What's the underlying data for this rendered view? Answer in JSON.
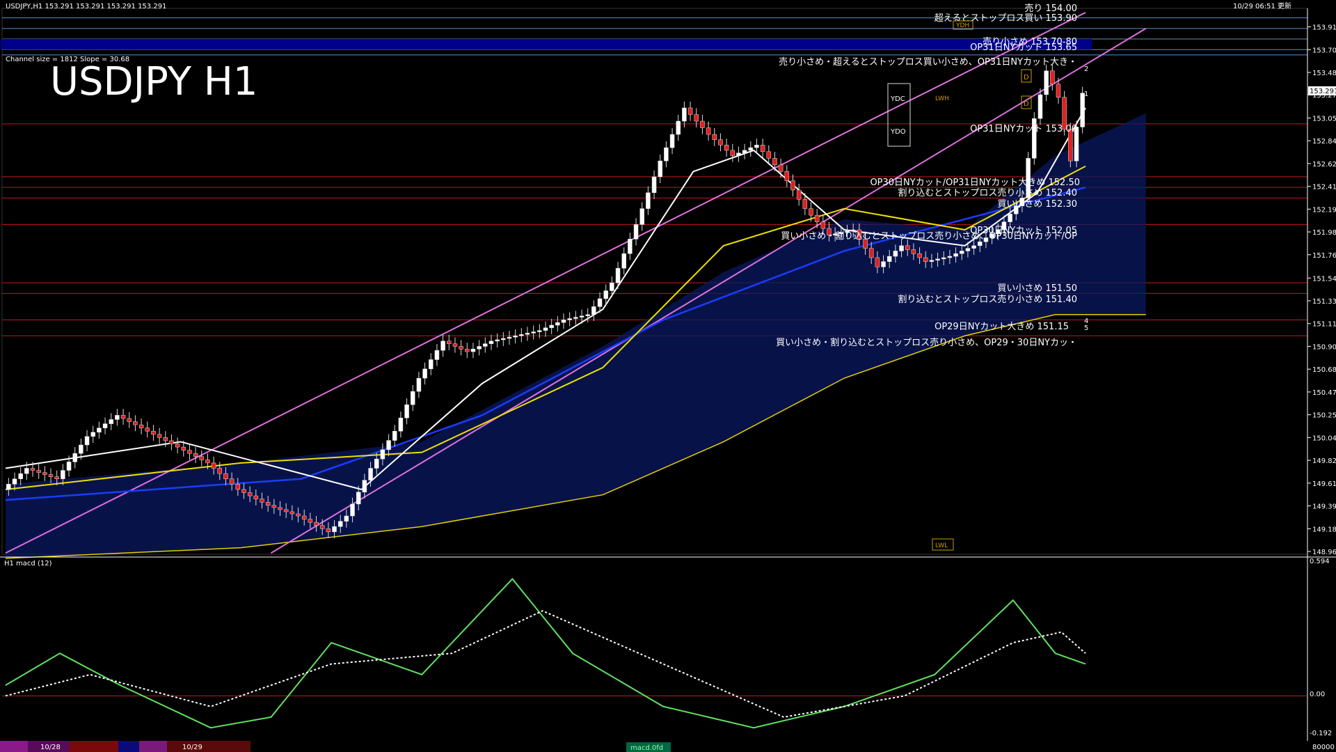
{
  "header": {
    "symbol_line": "USDJPY,H1  153.291 153.291 153.291 153.291",
    "datetime": "10/29 06:51 更新",
    "big_title": "USDJPY H1",
    "channel_info": "Channel size = 1812 Slope = 30.68"
  },
  "price_axis": {
    "ticks": [
      "153.915",
      "153.700",
      "153.485",
      "153.275",
      "153.055",
      "152.840",
      "152.625",
      "152.410",
      "152.195",
      "151.980",
      "151.765",
      "151.545",
      "151.330",
      "151.115",
      "150.900",
      "150.685",
      "150.470",
      "150.255",
      "150.040",
      "149.825",
      "149.610",
      "149.395",
      "149.180",
      "148.965"
    ],
    "current": "153.291"
  },
  "macd": {
    "title": "H1  macd (12)",
    "ticks": [
      "0.594",
      "0.00",
      "-0.192"
    ],
    "zero_label": "0.00"
  },
  "annotations": [
    {
      "text": "売り 154.00",
      "kind": "level"
    },
    {
      "text": "超えるとストップロス買い 153.90",
      "kind": "level"
    },
    {
      "text": "売り小さめ 153.70-80",
      "kind": "zone"
    },
    {
      "text": "OP31日NYカット 153.65",
      "kind": "level"
    },
    {
      "text": "売り小さめ・超えるとストップロス買い小さめ、OP31日NYカット大き・",
      "kind": "note"
    },
    {
      "text": "OP31日NYカット 153.00",
      "kind": "level"
    },
    {
      "text": "OP30日NYカット/OP31日NYカット大きめ 152.50",
      "kind": "level"
    },
    {
      "text": "割り込むとストップロス売り小さめ 152.40",
      "kind": "level"
    },
    {
      "text": "買い小さめ 152.30",
      "kind": "level"
    },
    {
      "text": "OP30日NYカット 152.05",
      "kind": "level"
    },
    {
      "text": "買い小さめ・割り込むとストップロス売り小さめ、OP30日NYカット/OP",
      "kind": "note"
    },
    {
      "text": "買い小さめ 151.50",
      "kind": "level"
    },
    {
      "text": "割り込むとストップロス売り小さめ 151.40",
      "kind": "level"
    },
    {
      "text": "OP29日NYカット大きめ 151.15",
      "kind": "level"
    },
    {
      "text": "買い小さめ・割り込むとストップロス売り小さめ、OP29・30日NYカッ・",
      "kind": "note"
    }
  ],
  "markers": {
    "ydh": "YDH",
    "ydc": "YDC",
    "ydo": "YDO",
    "lwh": "LWH",
    "lwl": "LWL",
    "d": "D",
    "n1": "1",
    "n2": "2",
    "n4": "4",
    "n5": "5"
  },
  "bottom_bar": {
    "left_date": "10/28",
    "mid_date": "10/29",
    "indicator_tab": "macd.0fd",
    "right_value": "80000"
  },
  "chart_data": {
    "type": "line",
    "title": "USDJPY H1",
    "ylim": [
      148.965,
      154.05
    ],
    "x": {
      "start": 1,
      "end": 180
    },
    "key_levels": [
      154.0,
      153.9,
      153.8,
      153.7,
      153.65,
      153.0,
      152.5,
      152.4,
      152.3,
      152.05,
      151.5,
      151.4,
      151.15,
      151.0
    ],
    "close_path": [
      [
        1,
        149.55
      ],
      [
        5,
        149.75
      ],
      [
        10,
        149.65
      ],
      [
        15,
        150.05
      ],
      [
        20,
        150.25
      ],
      [
        25,
        150.1
      ],
      [
        30,
        149.95
      ],
      [
        35,
        149.8
      ],
      [
        40,
        149.55
      ],
      [
        45,
        149.4
      ],
      [
        50,
        149.3
      ],
      [
        55,
        149.15
      ],
      [
        58,
        149.3
      ],
      [
        62,
        149.75
      ],
      [
        66,
        150.1
      ],
      [
        70,
        150.6
      ],
      [
        74,
        150.95
      ],
      [
        78,
        150.85
      ],
      [
        82,
        150.95
      ],
      [
        86,
        151.0
      ],
      [
        90,
        151.05
      ],
      [
        94,
        151.15
      ],
      [
        98,
        151.2
      ],
      [
        102,
        151.5
      ],
      [
        106,
        152.05
      ],
      [
        110,
        152.65
      ],
      [
        114,
        153.15
      ],
      [
        118,
        152.9
      ],
      [
        122,
        152.7
      ],
      [
        126,
        152.8
      ],
      [
        130,
        152.55
      ],
      [
        134,
        152.2
      ],
      [
        138,
        151.95
      ],
      [
        142,
        152.0
      ],
      [
        146,
        151.65
      ],
      [
        150,
        151.85
      ],
      [
        154,
        151.7
      ],
      [
        158,
        151.75
      ],
      [
        162,
        151.85
      ],
      [
        166,
        152.0
      ],
      [
        170,
        152.3
      ],
      [
        172,
        153.05
      ],
      [
        174,
        153.5
      ],
      [
        176,
        153.25
      ],
      [
        178,
        152.65
      ],
      [
        180,
        153.29
      ]
    ],
    "ma_fast": [
      [
        1,
        149.75
      ],
      [
        30,
        150.0
      ],
      [
        60,
        149.55
      ],
      [
        80,
        150.55
      ],
      [
        100,
        151.25
      ],
      [
        115,
        152.55
      ],
      [
        125,
        152.75
      ],
      [
        140,
        152.0
      ],
      [
        160,
        151.85
      ],
      [
        172,
        152.35
      ],
      [
        180,
        153.15
      ]
    ],
    "ma_mid": [
      [
        1,
        149.55
      ],
      [
        40,
        149.8
      ],
      [
        70,
        149.9
      ],
      [
        100,
        150.7
      ],
      [
        120,
        151.85
      ],
      [
        140,
        152.2
      ],
      [
        160,
        152.0
      ],
      [
        180,
        152.6
      ]
    ],
    "ma_slow": [
      [
        1,
        149.45
      ],
      [
        50,
        149.65
      ],
      [
        80,
        150.25
      ],
      [
        110,
        151.15
      ],
      [
        140,
        151.8
      ],
      [
        180,
        152.4
      ]
    ],
    "channel_upper": [
      [
        1,
        148.95
      ],
      [
        180,
        154.05
      ]
    ],
    "channel_lower": [
      [
        45,
        148.95
      ],
      [
        190,
        153.9
      ]
    ],
    "macd_line": [
      [
        1,
        0.05
      ],
      [
        10,
        0.2
      ],
      [
        20,
        0.05
      ],
      [
        35,
        -0.15
      ],
      [
        45,
        -0.1
      ],
      [
        55,
        0.25
      ],
      [
        70,
        0.1
      ],
      [
        85,
        0.55
      ],
      [
        95,
        0.2
      ],
      [
        110,
        -0.05
      ],
      [
        125,
        -0.15
      ],
      [
        140,
        -0.05
      ],
      [
        155,
        0.1
      ],
      [
        168,
        0.45
      ],
      [
        175,
        0.2
      ],
      [
        180,
        0.15
      ]
    ],
    "macd_signal": [
      [
        1,
        0.0
      ],
      [
        15,
        0.1
      ],
      [
        35,
        -0.05
      ],
      [
        55,
        0.15
      ],
      [
        75,
        0.2
      ],
      [
        90,
        0.4
      ],
      [
        110,
        0.15
      ],
      [
        130,
        -0.1
      ],
      [
        150,
        0.0
      ],
      [
        168,
        0.25
      ],
      [
        176,
        0.3
      ],
      [
        180,
        0.2
      ]
    ]
  }
}
